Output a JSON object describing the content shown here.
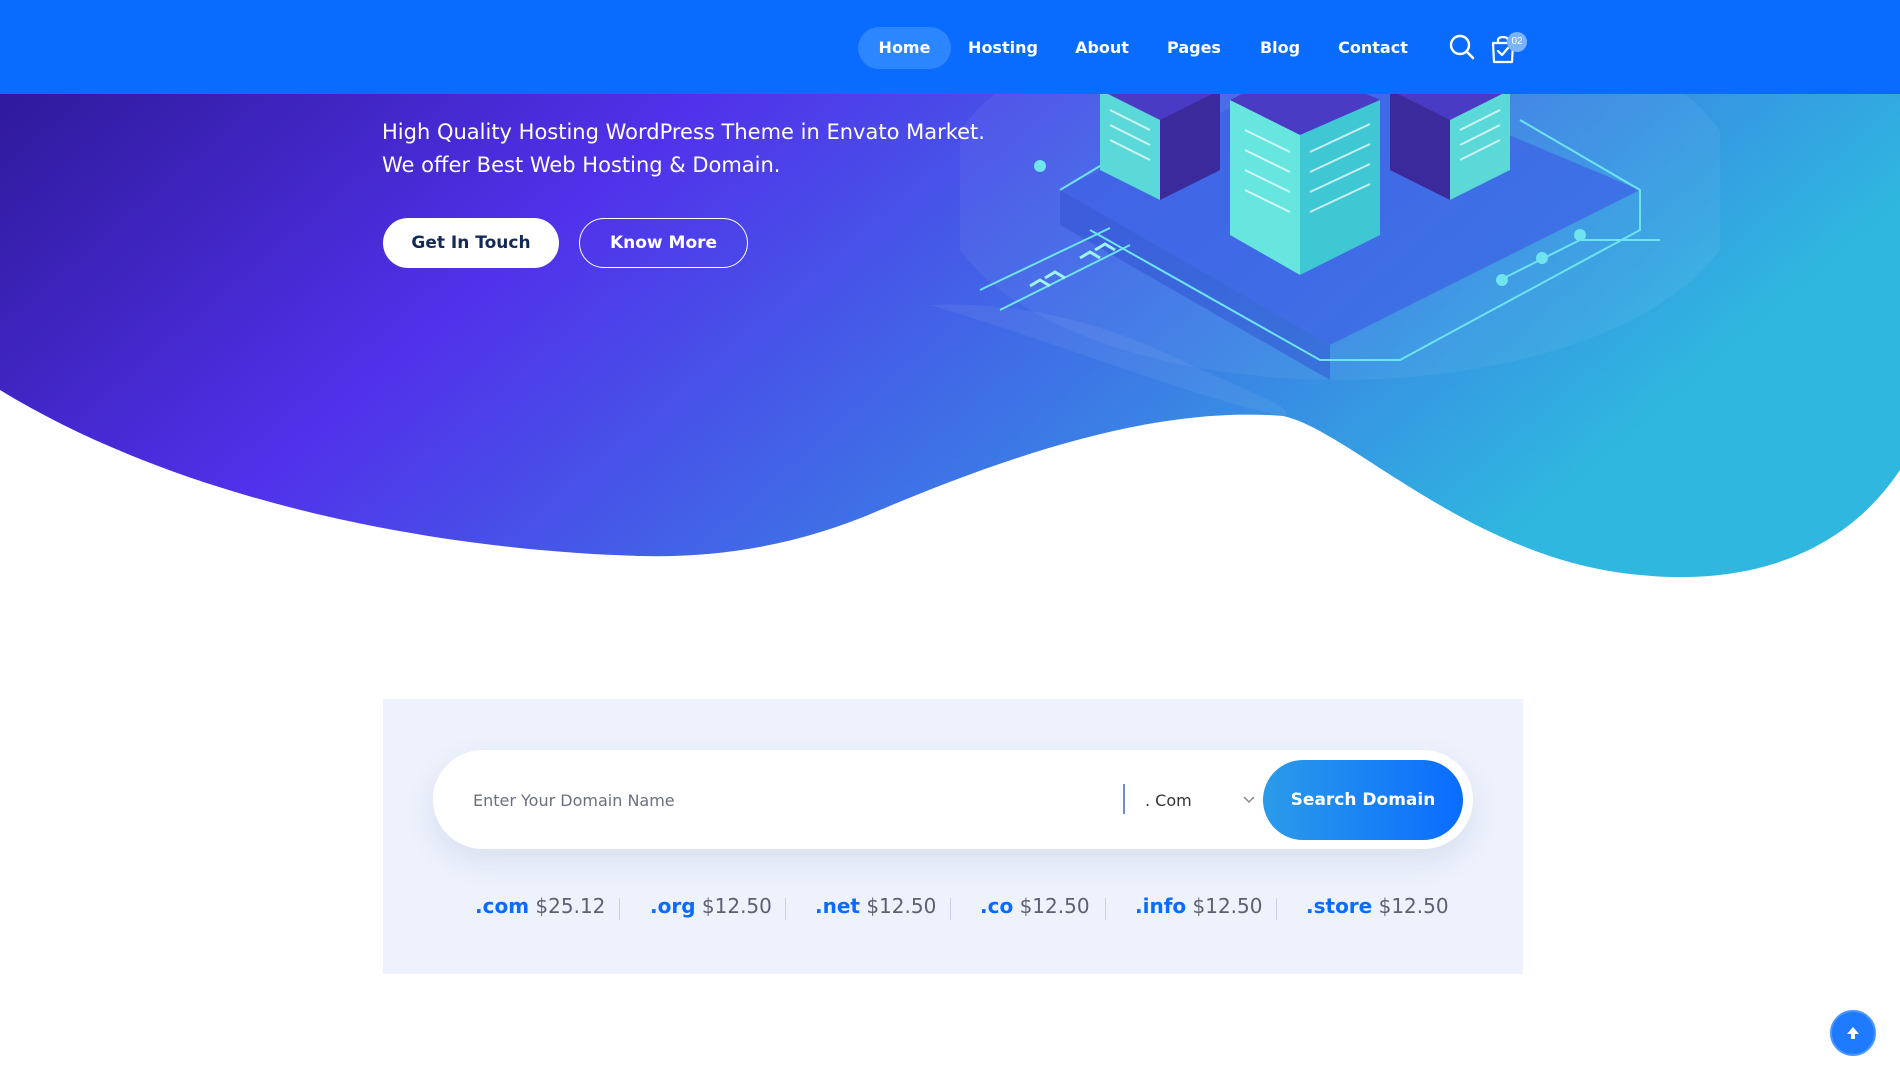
{
  "nav": {
    "items": [
      {
        "label": "Home"
      },
      {
        "label": "Hosting"
      },
      {
        "label": "About"
      },
      {
        "label": "Pages"
      },
      {
        "label": "Blog"
      },
      {
        "label": "Contact"
      }
    ],
    "search_icon": "search-icon",
    "cart_icon": "shopping-bag-icon",
    "cart_count": "02"
  },
  "hero": {
    "line1": "High Quality Hosting WordPress Theme in Envato Market.",
    "line2": "We offer Best Web Hosting & Domain.",
    "primary_button": "Get In Touch",
    "secondary_button": "Know More"
  },
  "domain_search": {
    "placeholder": "Enter Your Domain Name",
    "extension_selected": ". Com",
    "button_label": "Search Domain",
    "prices": [
      {
        "ext": ".com",
        "price": "$25.12"
      },
      {
        "ext": ".org",
        "price": "$12.50"
      },
      {
        "ext": ".net",
        "price": "$12.50"
      },
      {
        "ext": ".co",
        "price": "$12.50"
      },
      {
        "ext": ".info",
        "price": "$12.50"
      },
      {
        "ext": ".store",
        "price": "$12.50"
      }
    ]
  },
  "scroll_top_icon": "arrow-up-icon",
  "colors": {
    "nav_bg": "#0a6cff",
    "accent": "#0a6cff",
    "hero_purple": "#4f32e8",
    "hero_cyan": "#2fb3e0",
    "panel_bg": "#edf2fc"
  }
}
